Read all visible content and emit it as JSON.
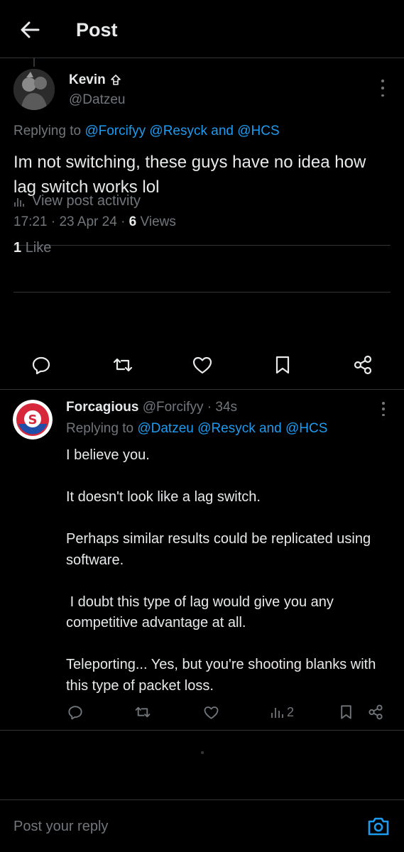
{
  "header": {
    "title": "Post",
    "back_icon": "arrow-left-icon"
  },
  "post": {
    "author": {
      "name": "Kevin",
      "name_suffix_icon": "protected-icon",
      "handle": "@Datzeu"
    },
    "replying_prefix": "Replying to",
    "replying_mentions": [
      "@Forcifyy",
      "@Resyck"
    ],
    "replying_and": "and",
    "replying_last": "@HCS",
    "text": "Im not switching, these guys have no idea how lag switch works lol",
    "time": "17:21",
    "date": "23 Apr 24",
    "views_count": "6",
    "views_label": "Views",
    "activity_label": "View post activity",
    "likes_count": "1",
    "likes_label": "Like",
    "actions": [
      "reply-icon",
      "repost-icon",
      "like-icon",
      "bookmark-icon",
      "share-icon"
    ]
  },
  "reply": {
    "name": "Forcagious",
    "handle": "@Forcifyy",
    "time": "34s",
    "replying_prefix": "Replying to",
    "replying_mentions": [
      "@Datzeu",
      "@Resyck"
    ],
    "replying_and": "and",
    "replying_last": "@HCS",
    "paragraphs": [
      "I believe you.",
      "It doesn't look like a lag switch.",
      "Perhaps similar results could be replicated using software.",
      " I doubt this type of lag would give you any competitive advantage at all.",
      "Teleporting... Yes, but you're shooting blanks with this type of packet loss."
    ],
    "views_count": "2",
    "actions": [
      "reply-icon",
      "repost-icon",
      "like-icon",
      "views-icon",
      "bookmark-icon",
      "share-icon"
    ]
  },
  "compose": {
    "placeholder": "Post your reply",
    "camera_icon": "camera-icon"
  },
  "colors": {
    "background": "#000000",
    "text": "#e7e9ea",
    "muted": "#71767b",
    "link": "#1d9bf0",
    "border": "#2f3336"
  }
}
